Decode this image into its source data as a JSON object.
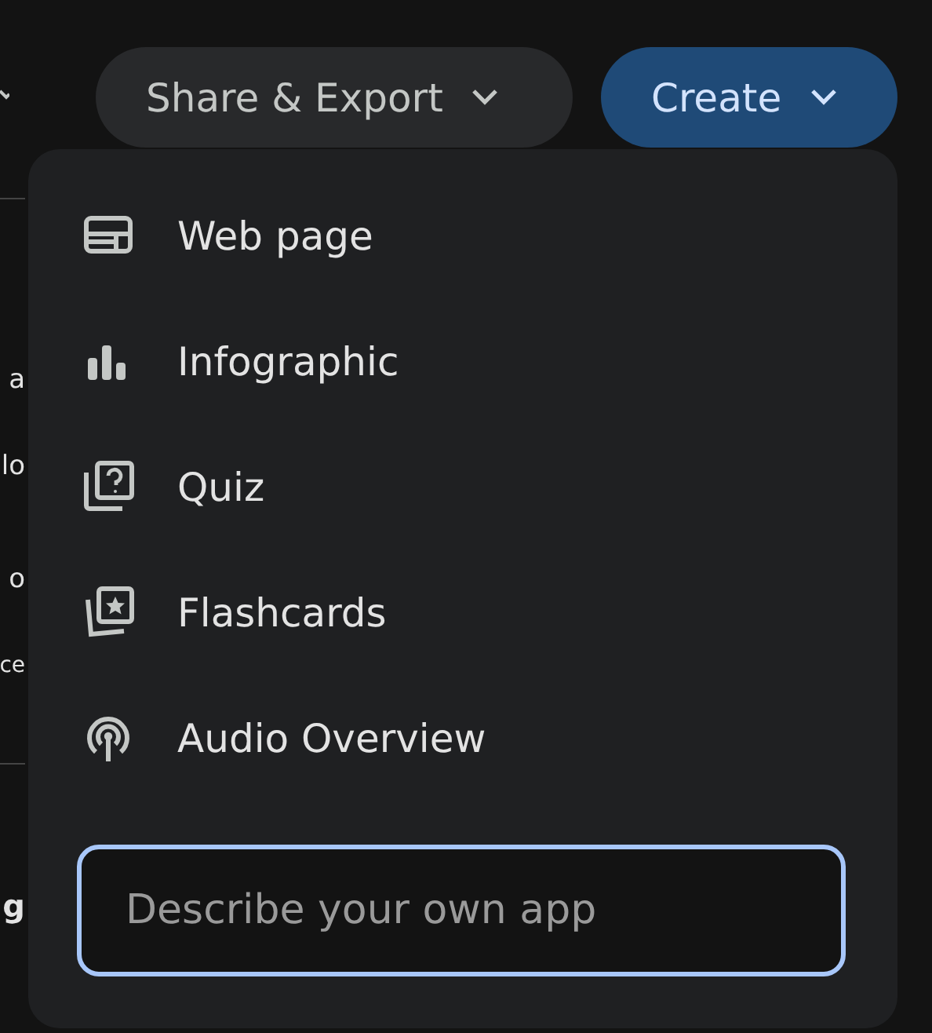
{
  "background_text": [
    "a",
    "lo",
    "o",
    "ce",
    "g"
  ],
  "share_button": {
    "label": "Share & Export"
  },
  "create_button": {
    "label": "Create",
    "expanded": true
  },
  "menu": {
    "items": [
      {
        "label": "Web page"
      },
      {
        "label": "Infographic"
      },
      {
        "label": "Quiz"
      },
      {
        "label": "Flashcards"
      },
      {
        "label": "Audio Overview"
      }
    ],
    "input": {
      "placeholder": "Describe your own app"
    }
  }
}
